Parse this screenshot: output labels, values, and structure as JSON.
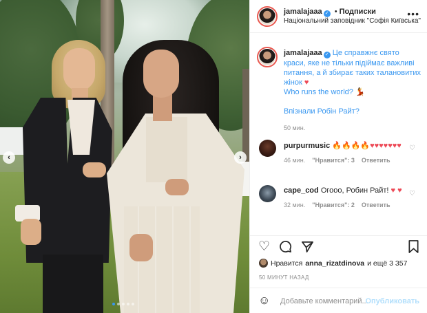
{
  "post": {
    "username": "jamalajaaa",
    "verified_glyph": "✓",
    "follow_separator": "•",
    "follow_label": "Подписки",
    "location": "Національний заповідник \"Софія Київська\"",
    "more_label": "•••",
    "photo_nav": {
      "prev": "‹",
      "next": "›",
      "dots": 5,
      "active_dot": 1
    }
  },
  "caption": {
    "username": "jamalajaaa",
    "line1": "Це справжнє свято краси, яке не тільки підіймає важливі питання, а й збирає таких талановитих жінок",
    "heart": "♥",
    "line2": "Who runs the world?",
    "emoji2": "💃",
    "line3": "Впізнали Робін Райт?",
    "time": "50 мин."
  },
  "comments": [
    {
      "username": "purpurmusic",
      "text": "🔥🔥🔥🔥♥♥♥♥♥♥♥",
      "time": "46 мин.",
      "likes": "\"Нравится\": 3",
      "reply": "Ответить"
    },
    {
      "username": "cape_cod",
      "text": "Огооо, Робин Райт!",
      "hearts": "♥ ♥",
      "time": "32 мин.",
      "likes": "\"Нравится\": 2",
      "reply": "Ответить"
    }
  ],
  "actions": {
    "like_icon": "heart-outline-icon",
    "comment_icon": "comment-icon",
    "share_icon": "paper-plane-icon",
    "save_icon": "bookmark-icon"
  },
  "likes": {
    "prefix": "Нравится",
    "user": "anna_rizatdinova",
    "suffix": "и ещё 3 357"
  },
  "timestamp": "50 МИНУТ НАЗАД",
  "add_comment": {
    "placeholder": "Добавьте комментарий...",
    "publish": "Опубликовать"
  },
  "colors": {
    "accent": "#3897f0",
    "heart": "#ed4956",
    "muted": "#8e8e8e"
  }
}
